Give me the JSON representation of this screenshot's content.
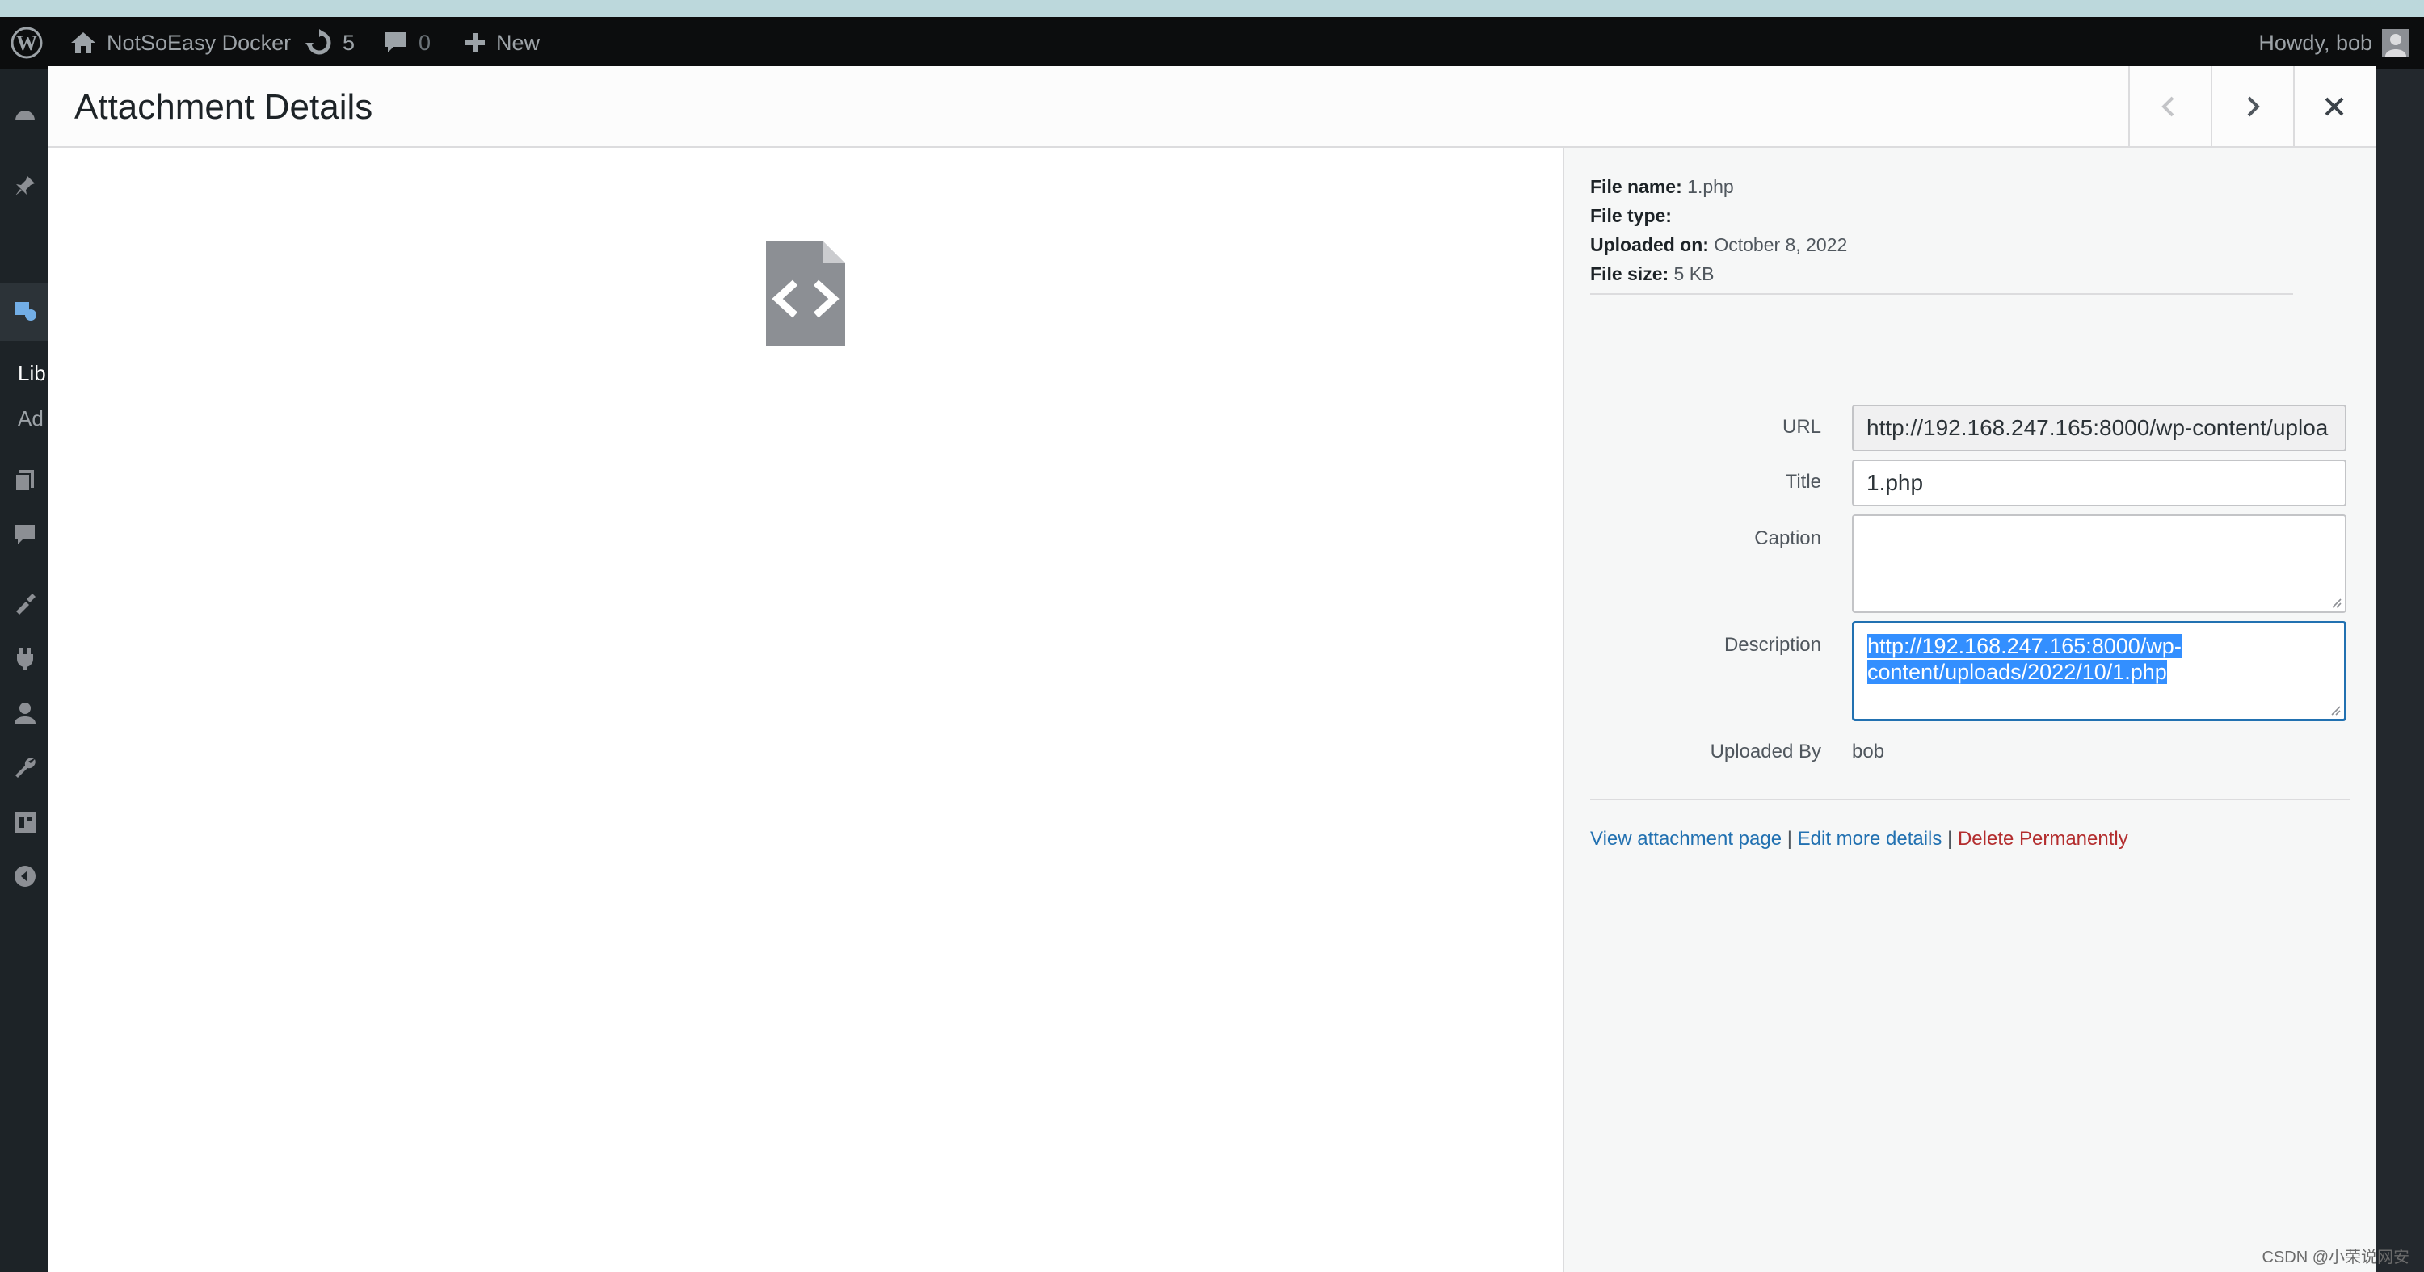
{
  "adminbar": {
    "site_name": "NotSoEasy Docker",
    "updates_count": "5",
    "comments_count": "0",
    "new_label": "New",
    "howdy": "Howdy, bob"
  },
  "sidebar": {
    "submenu": [
      "Lib",
      "Ad"
    ]
  },
  "modal": {
    "title": "Attachment Details"
  },
  "details": {
    "file_name_label": "File name:",
    "file_name": "1.php",
    "file_type_label": "File type:",
    "file_type": "",
    "uploaded_on_label": "Uploaded on:",
    "uploaded_on": "October 8, 2022",
    "file_size_label": "File size:",
    "file_size": "5 KB",
    "url_label": "URL",
    "url_value": "http://192.168.247.165:8000/wp-content/uploa",
    "title_label": "Title",
    "title_value": "1.php",
    "caption_label": "Caption",
    "caption_value": "",
    "description_label": "Description",
    "description_line1": "http://192.168.247.165:8000/wp-",
    "description_line2": "content/uploads/2022/10/1.php",
    "uploaded_by_label": "Uploaded By",
    "uploaded_by": "bob"
  },
  "actions": {
    "view": "View attachment page",
    "sep": "|",
    "edit": "Edit more details",
    "delete": "Delete Permanently"
  },
  "watermark": "CSDN @小荣说网安",
  "colors": {
    "accent": "#2271b1",
    "danger": "#b32d2e",
    "selection": "#338fff",
    "adminbar": "#0c0d0e"
  }
}
